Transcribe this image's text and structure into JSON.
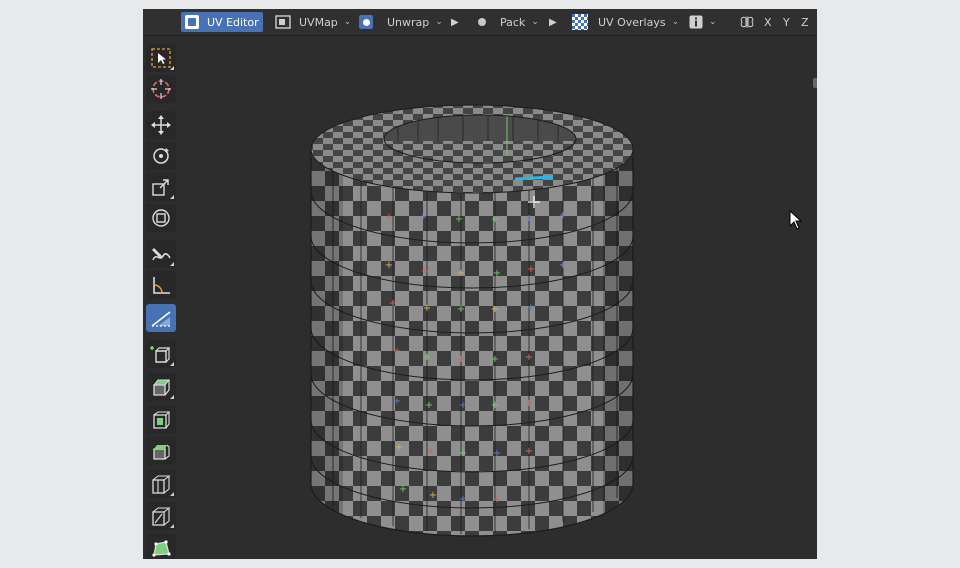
{
  "header": {
    "editor_label": "UV Editor",
    "uvmap_label": "UVMap",
    "unwrap_label": "Unwrap",
    "pack_label": "Pack",
    "overlays_label": "UV Overlays",
    "axis_x": "X",
    "axis_y": "Y",
    "axis_z": "Z"
  },
  "colors": {
    "accent": "#4772b3",
    "selected_edge": "#2ab7e8"
  },
  "tools": [
    {
      "name": "select-box",
      "icon": "select-box-icon"
    },
    {
      "name": "cursor",
      "icon": "cursor-icon"
    },
    {
      "name": "move",
      "icon": "move-icon"
    },
    {
      "name": "rotate",
      "icon": "rotate-icon"
    },
    {
      "name": "scale",
      "icon": "scale-icon"
    },
    {
      "name": "transform",
      "icon": "transform-icon"
    },
    {
      "name": "annotate",
      "icon": "annotate-icon"
    },
    {
      "name": "measure",
      "icon": "measure-icon"
    },
    {
      "name": "uv-tool",
      "icon": "uv-tool-icon",
      "active": true
    },
    {
      "name": "add-cube",
      "icon": "add-cube-icon"
    },
    {
      "name": "extrude",
      "icon": "extrude-icon"
    },
    {
      "name": "inset",
      "icon": "inset-icon"
    },
    {
      "name": "bevel",
      "icon": "bevel-icon"
    },
    {
      "name": "loop-cut",
      "icon": "loop-cut-icon"
    },
    {
      "name": "knife",
      "icon": "knife-icon"
    },
    {
      "name": "poly-build",
      "icon": "poly-build-icon"
    }
  ]
}
